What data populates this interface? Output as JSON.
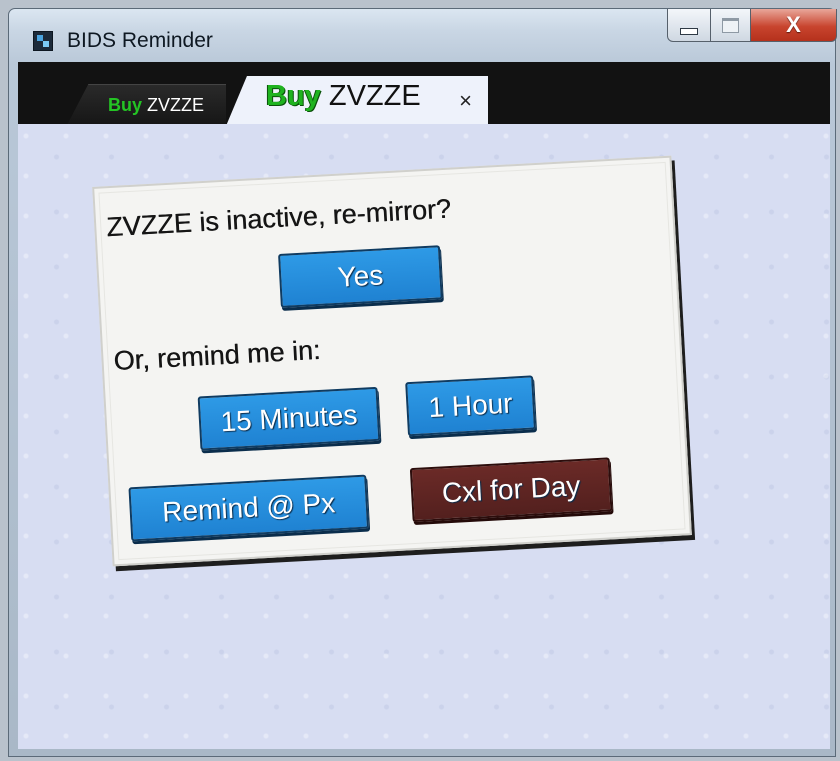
{
  "window": {
    "title": "BIDS Reminder",
    "close_glyph": "X"
  },
  "tabs": {
    "inactive": {
      "buy": "Buy",
      "symbol": "ZVZZE"
    },
    "active": {
      "buy": "Buy",
      "symbol": "ZVZZE",
      "close": "×"
    }
  },
  "dialog": {
    "prompt": "ZVZZE is inactive, re-mirror?",
    "yes_label": "Yes",
    "remind_prompt": "Or, remind me in:",
    "btn_15": "15 Minutes",
    "btn_1h": "1 Hour",
    "btn_remind_px": "Remind @ Px",
    "btn_cxl": "Cxl for Day"
  },
  "colors": {
    "button_blue": "#2596e3",
    "button_dark_red": "#5f2522",
    "buy_green": "#1fb31f",
    "content_bg": "#d7ddf2"
  },
  "icons": [
    "app-icon",
    "minimize-icon",
    "maximize-icon",
    "close-icon",
    "tab-close-icon"
  ]
}
